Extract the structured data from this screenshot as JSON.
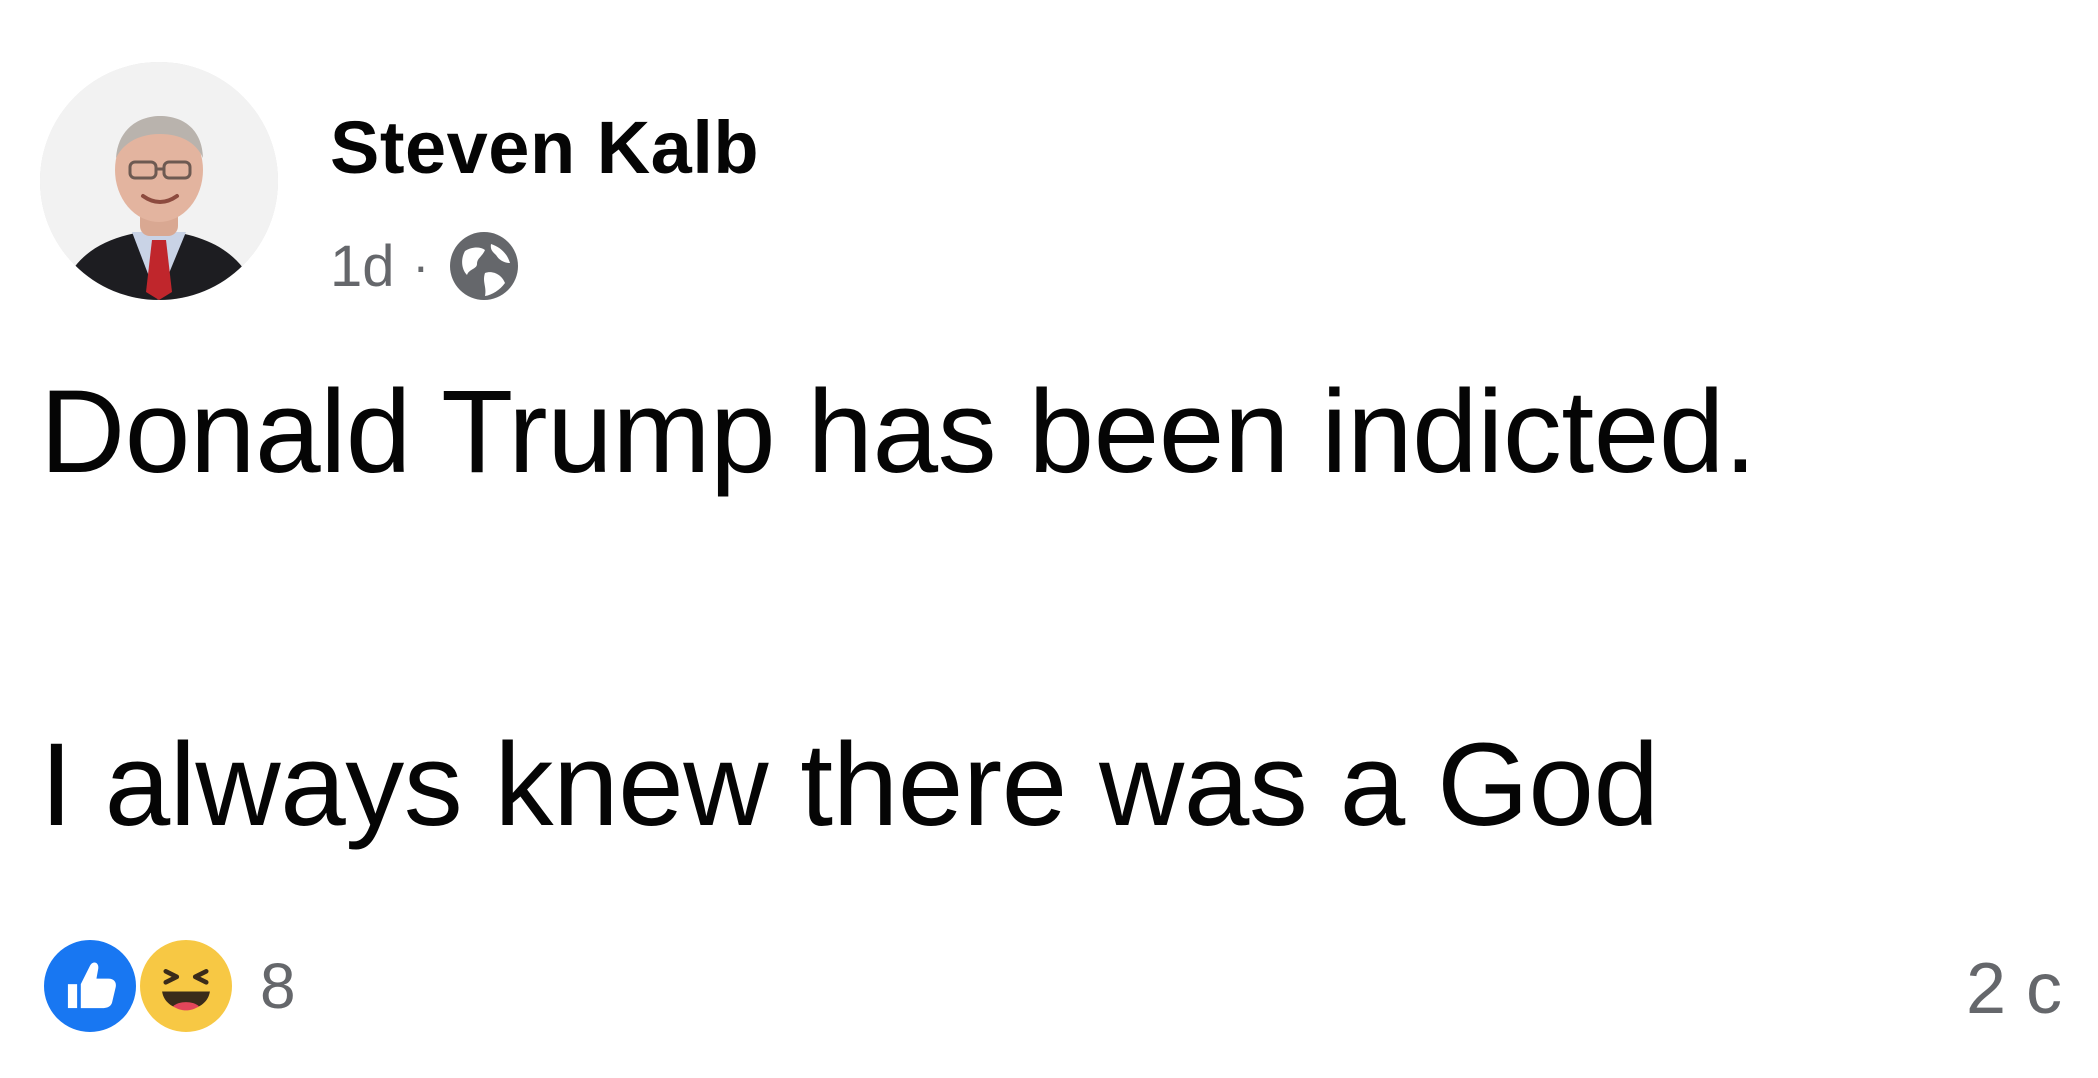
{
  "post": {
    "author": {
      "name": "Steven Kalb",
      "avatar_icon": "profile-photo"
    },
    "meta": {
      "time": "1d",
      "separator": "·",
      "audience_icon": "globe-icon"
    },
    "text": {
      "line1": "Donald Trump has been indicted.",
      "line2": "I always knew there was a God"
    },
    "reactions": {
      "icons": [
        "like-icon",
        "haha-icon"
      ],
      "count": "8"
    },
    "comments": {
      "label": "2 c"
    }
  },
  "colors": {
    "like_blue": "#1877f2",
    "haha_yellow": "#f7c844",
    "secondary_text": "#65676b",
    "primary_text": "#050505"
  }
}
